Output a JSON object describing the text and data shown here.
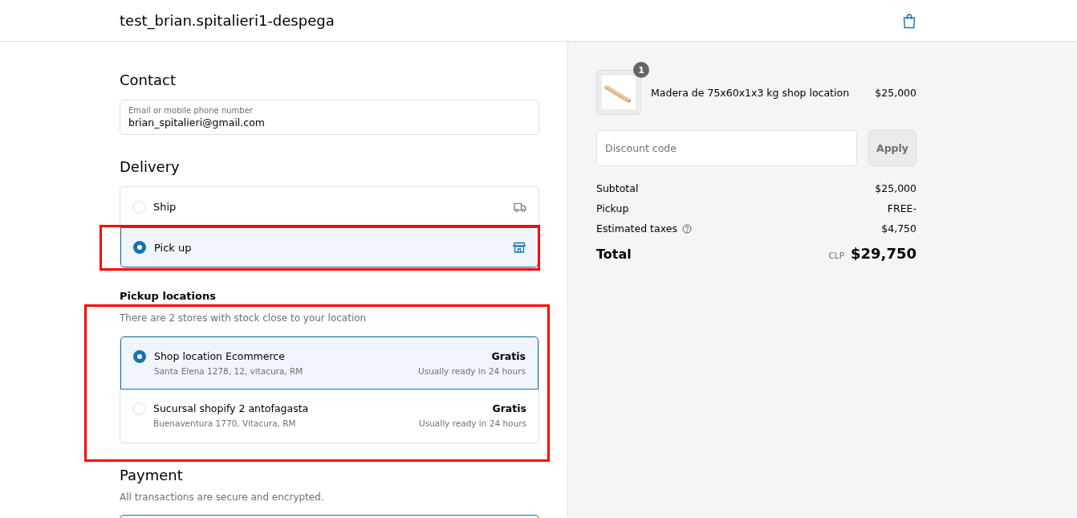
{
  "header": {
    "store_name": "test_brian.spitalieri1-despega"
  },
  "contact": {
    "title": "Contact",
    "field": {
      "label": "Email or mobile phone number",
      "value": "brian_spitalieri@gmail.com"
    }
  },
  "delivery": {
    "title": "Delivery",
    "options": [
      {
        "label": "Ship",
        "kind": "ship",
        "selected": false
      },
      {
        "label": "Pick up",
        "kind": "pickup",
        "selected": true
      }
    ]
  },
  "pickup_locations": {
    "title": "Pickup locations",
    "subtitle": "There are 2 stores with stock close to your location",
    "locations": [
      {
        "name": "Shop location Ecommerce",
        "address": "Santa Elena 1278, 12, vitacura, RM",
        "price": "Gratis",
        "ready": "Usually ready in 24 hours",
        "selected": true
      },
      {
        "name": "Sucursal shopify 2 antofagasta",
        "address": "Buenaventura 1770, Vitacura, RM",
        "price": "Gratis",
        "ready": "Usually ready in 24 hours",
        "selected": false
      }
    ]
  },
  "payment": {
    "title": "Payment",
    "subtitle": "All transactions are secure and encrypted."
  },
  "order_summary": {
    "item": {
      "quantity": "1",
      "name": "Madera de 75x60x1x3 kg shop location",
      "price": "$25,000"
    },
    "discount": {
      "placeholder": "Discount code",
      "button": "Apply"
    },
    "lines": [
      {
        "label": "Subtotal",
        "value": "$25,000",
        "info": false
      },
      {
        "label": "Pickup",
        "value": "FREE-",
        "info": false
      },
      {
        "label": "Estimated taxes",
        "value": "$4,750",
        "info": true
      }
    ],
    "total": {
      "label": "Total",
      "currency": "CLP",
      "value": "$29,750"
    }
  }
}
